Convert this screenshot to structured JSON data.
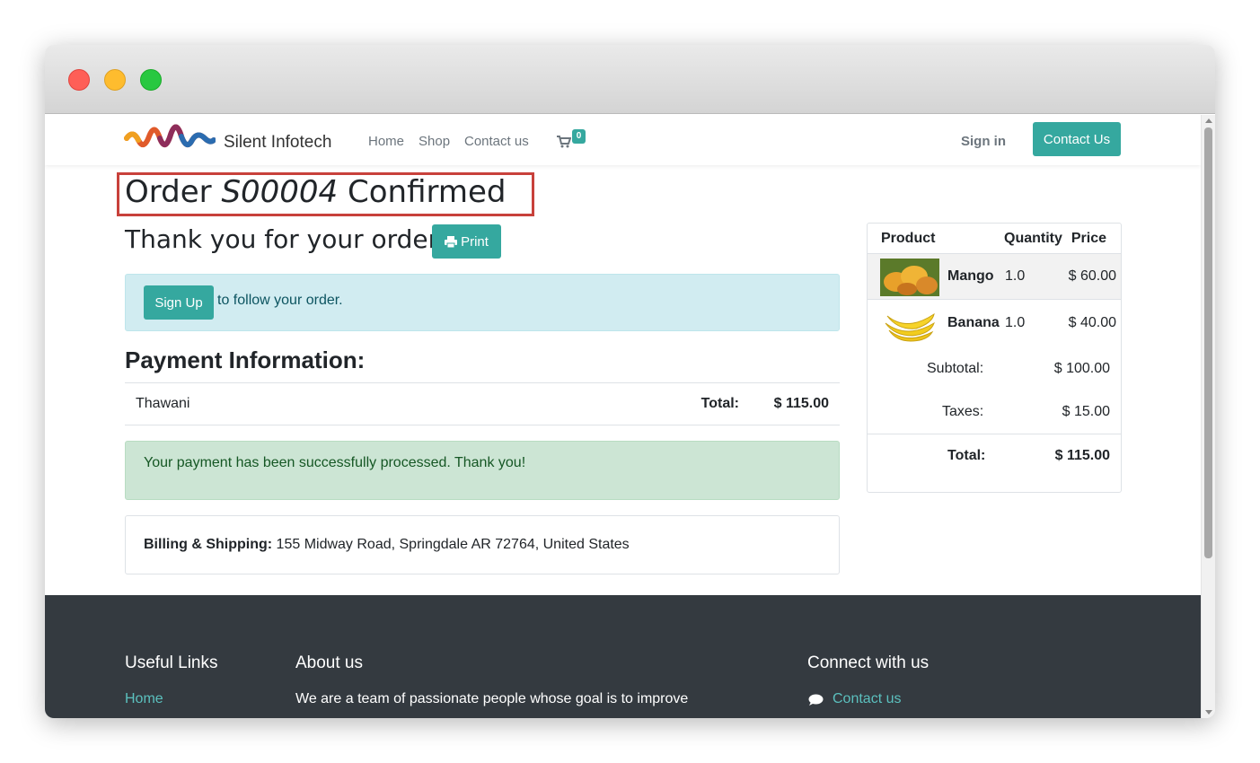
{
  "brand": {
    "name": "Silent Infotech"
  },
  "nav": {
    "items": [
      {
        "label": "Home"
      },
      {
        "label": "Shop"
      },
      {
        "label": "Contact us"
      }
    ],
    "cart_count": "0",
    "sign_in": "Sign in",
    "contact_button": "Contact Us"
  },
  "order": {
    "title_prefix": "Order ",
    "order_number": "S00004",
    "title_suffix": " Confirmed",
    "thank_you": "Thank you for your order.",
    "print_label": "Print"
  },
  "signup_alert": {
    "button": "Sign Up",
    "text": "to follow your order."
  },
  "payment": {
    "heading": "Payment Information:",
    "method": "Thawani",
    "total_label": "Total:",
    "total_value": "$ 115.00",
    "success_message": "Your payment has been successfully processed. Thank you!"
  },
  "billing": {
    "label": "Billing & Shipping:",
    "address": "155 Midway Road, Springdale AR 72764, United States"
  },
  "summary": {
    "headers": {
      "product": "Product",
      "quantity": "Quantity",
      "price": "Price"
    },
    "items": [
      {
        "name": "Mango",
        "qty": "1.0",
        "price": "$ 60.00",
        "image": "mango-image"
      },
      {
        "name": "Banana",
        "qty": "1.0",
        "price": "$ 40.00",
        "image": "banana-image"
      }
    ],
    "subtotal_label": "Subtotal:",
    "subtotal_value": "$ 100.00",
    "taxes_label": "Taxes:",
    "taxes_value": "$ 15.00",
    "total_label": "Total:",
    "total_value": "$ 115.00"
  },
  "footer": {
    "useful_links_heading": "Useful Links",
    "useful_links": [
      "Home"
    ],
    "about_heading": "About us",
    "about_text": "We are a team of passionate people whose goal is to improve",
    "connect_heading": "Connect with us",
    "connect_links": [
      "Contact us"
    ]
  },
  "colors": {
    "accent": "#35a89f",
    "info_bg": "#d1ecf1",
    "success_bg": "#cce5d4",
    "footer_bg": "#343a40",
    "highlight_border": "#c8413b"
  }
}
